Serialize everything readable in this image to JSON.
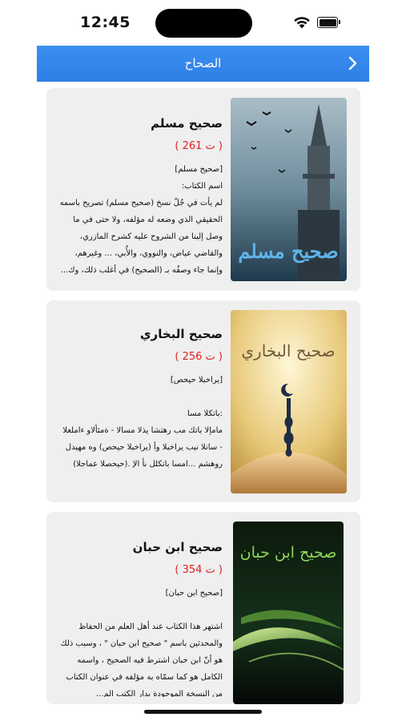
{
  "status_bar": {
    "time": "12:45"
  },
  "navbar": {
    "title": "الصحاح"
  },
  "books": [
    {
      "title": "صحيح مسلم",
      "year": "( ت 261 )",
      "excerpt": "[صحيح مسلم]\nاسم الكتاب:\nلم يأت في جُلّ نسخ (صحيح مسلم) تصريح باسمه الحقيقي الذي وضعه له مؤلفه، ولا حتى في ما وصل إلينا من الشروح عليه كشرح المازري، والقاضي عياض، والنووي، والأُبي، ... وغيرهم، وإنما جاء وصفُه بـ (الصحيح) في أغلب ذلك، وك...",
      "cover_text": "صحيح مسلم"
    },
    {
      "title": "صحيح البخاري",
      "year": "( ت 256 )",
      "excerpt": "[ي‍راخبلا حيحص]\n\n:باتكلا مسا\nمامإلا باتك مب رهتشا يذلا مسالا - ةمئألاو ءاملعلا - سانلا نيب يراخبلا وأ (يراخبلا حيحص) وه مهيدل روهشم ...امسا باتكلل نأ الإ .(حيحصلا عماجلا)",
      "cover_text": "صحيح البخاري"
    },
    {
      "title": "صحيح ابن حبان",
      "year": "( ت 354 )",
      "excerpt": "[صحيح ابن حبان]\n\nاشتهر هذا الكتاب عند أهل العلم من الحفاظ والمحدثين باسم \" صحيح ابن حبان \" ، وسبب ذلك هو أنّ ابن حبان اشترط فيه الصحيح ، واسمه الكامل هو كما سمّاه به مؤلفه في عنوان الكتاب من النسخة الموجودة بدار الكتب الم...",
      "cover_text": "صحيح ابن حبان"
    }
  ],
  "colors": {
    "nav_bar": "#2e7fe6",
    "year_text": "#e02020",
    "card_bg": "#efefef"
  },
  "icons": {
    "back": "chevron-right-icon",
    "wifi": "wifi-icon",
    "battery": "battery-icon"
  }
}
